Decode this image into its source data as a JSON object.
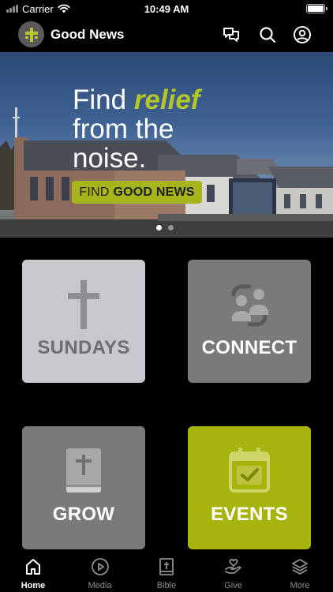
{
  "status_bar": {
    "carrier": "Carrier",
    "time": "10:49 AM",
    "battery_level": 1.0
  },
  "header": {
    "title": "Good News",
    "icons": [
      "chat-icon",
      "search-icon",
      "profile-icon"
    ]
  },
  "banner": {
    "headline_part1": "Find ",
    "headline_accent": "relief",
    "headline_line2": "from the",
    "headline_line3": "noise.",
    "button_prefix": "FIND",
    "button_bold": "GOOD NEWS",
    "accent_color": "#b5c62a",
    "slides": 2,
    "active_slide": 1
  },
  "tiles": [
    {
      "label": "SUNDAYS",
      "icon": "cross-icon",
      "color": "#c8c8cc"
    },
    {
      "label": "CONNECT",
      "icon": "people-icon",
      "color": "#7a7a7d"
    },
    {
      "label": "GROW",
      "icon": "bible-icon",
      "color": "#7a7a7d"
    },
    {
      "label": "EVENTS",
      "icon": "calendar-check-icon",
      "color": "#a8b40e"
    }
  ],
  "tab_bar": {
    "active": "Home",
    "items": [
      {
        "label": "Home",
        "icon": "home-icon"
      },
      {
        "label": "Media",
        "icon": "play-icon"
      },
      {
        "label": "Bible",
        "icon": "bible-icon"
      },
      {
        "label": "Give",
        "icon": "give-icon"
      },
      {
        "label": "More",
        "icon": "layers-icon"
      }
    ]
  }
}
